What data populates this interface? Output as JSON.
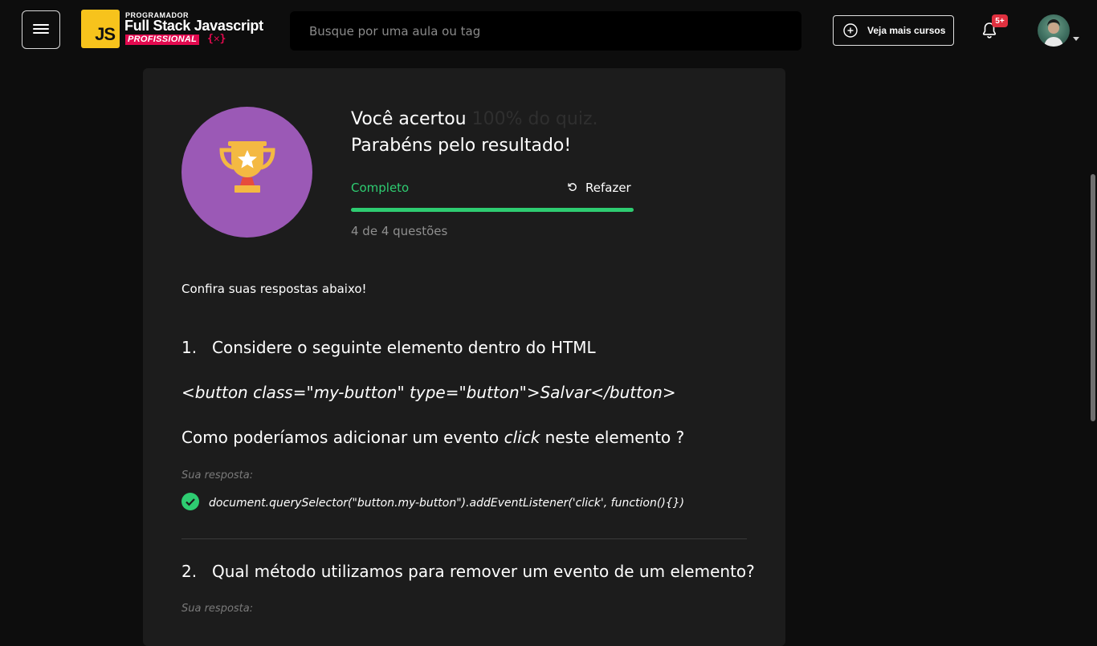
{
  "header": {
    "logo": {
      "badge": "JS",
      "top_line": "PROGRAMADOR",
      "main_line": "Full Stack Javascript",
      "sub_line": "PROFISSIONAL",
      "braces": "{✕}"
    },
    "search": {
      "placeholder": "Busque por uma aula ou tag",
      "value": ""
    },
    "more_courses_label": "Veja mais cursos",
    "notifications_badge": "5+"
  },
  "result": {
    "line1_prefix": "Você acertou",
    "line1_score": "100% do quiz.",
    "line2": "Parabéns pelo resultado!",
    "status": "Completo",
    "redo_label": "Refazer",
    "progress_percent": 100,
    "question_count": "4 de 4 questões"
  },
  "intro": "Confira suas respostas abaixo!",
  "questions": [
    {
      "number": "1.",
      "title": "Considere o seguinte elemento dentro do HTML",
      "code": "<button class=\"my-button\" type=\"button\">Salvar</button>",
      "sub_before": "Como poderíamos adicionar um evento ",
      "sub_em": "click",
      "sub_after": " neste elemento ?",
      "answer_label": "Sua resposta:",
      "answer": "document.querySelector(\"button.my-button\").addEventListener('click', function(){})"
    },
    {
      "number": "2.",
      "title": "Qual método utilizamos para remover um evento de um elemento?",
      "answer_label": "Sua resposta:"
    }
  ],
  "colors": {
    "background": "#0d0d0d",
    "card": "#1c1c1c",
    "accent_green": "#2ecc71",
    "trophy_circle": "#9b59b6",
    "logo_yellow": "#f7c31c",
    "brand_red": "#e30a4f",
    "badge_red": "#e0303f"
  },
  "icons": [
    "hamburger-menu-icon",
    "plus-circle-icon",
    "bell-icon",
    "chevron-down-icon",
    "trophy-icon",
    "refresh-icon",
    "check-circle-icon"
  ]
}
